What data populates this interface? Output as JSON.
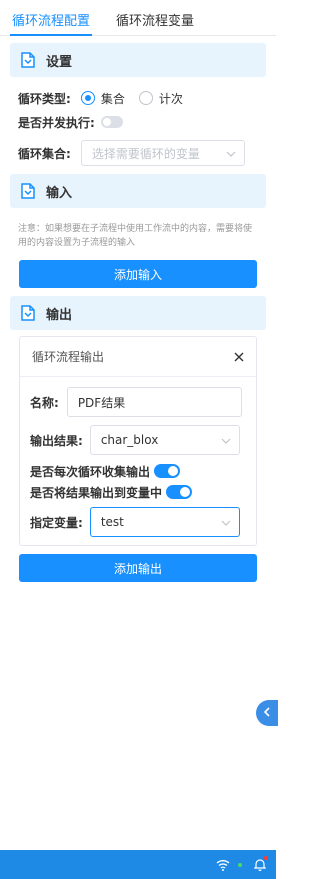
{
  "tabs": [
    {
      "label": "循环流程配置",
      "active": true
    },
    {
      "label": "循环流程变量",
      "active": false
    }
  ],
  "settings": {
    "title": "设置",
    "loop_type_label": "循环类型:",
    "loop_type_options": [
      "集合",
      "计次"
    ],
    "loop_type_selected": "集合",
    "parallel_label": "是否并发执行:",
    "parallel_enabled": false,
    "collection_label": "循环集合:",
    "collection_placeholder": "选择需要循环的变量"
  },
  "input_section": {
    "title": "输入",
    "note": "注意：如果想要在子流程中使用工作流中的内容，需要将使用的内容设置为子流程的输入",
    "add_button": "添加输入"
  },
  "output_section": {
    "title": "输出",
    "card_title": "循环流程输出",
    "name_label": "名称:",
    "name_value": "PDF结果",
    "result_label": "输出结果:",
    "result_value": "char_blox",
    "collect_each_label": "是否每次循环收集输出",
    "collect_each_enabled": true,
    "output_to_var_label": "是否将结果输出到变量中",
    "output_to_var_enabled": true,
    "target_var_label": "指定变量:",
    "target_var_value": "test",
    "add_button": "添加输出"
  },
  "colors": {
    "accent": "#1890ff",
    "section_bg": "#e8f4fd",
    "taskbar": "#1e8ae6"
  }
}
